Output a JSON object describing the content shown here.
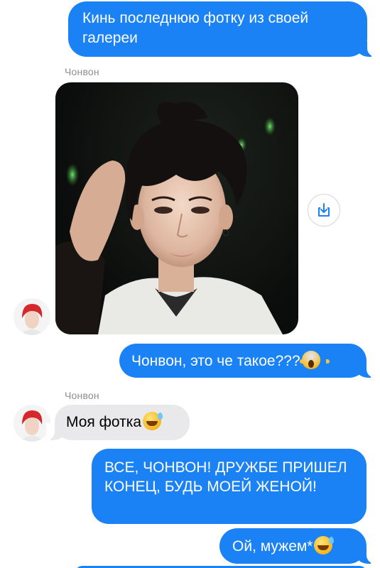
{
  "conversation": {
    "messages": [
      {
        "direction": "outgoing",
        "text": "Кинь последнюю фотку из своей галереи"
      },
      {
        "direction": "incoming",
        "sender": "Чонвон",
        "type": "image"
      },
      {
        "direction": "outgoing",
        "text": "Чонвон, это че такое???",
        "emoji": "face-screaming-in-fear"
      },
      {
        "direction": "incoming",
        "sender": "Чонвон",
        "text": "Моя фотка",
        "emoji": "grinning-face-with-sweat"
      },
      {
        "direction": "outgoing",
        "text": "ВСЕ, ЧОНВОН! ДРУЖБЕ ПРИШЕЛ КОНЕЦ, БУДЬ МОЕЙ ЖЕНОЙ!"
      },
      {
        "direction": "outgoing",
        "text": "Ой, мужем*",
        "emoji": "grinning-face-with-sweat"
      }
    ]
  },
  "colors": {
    "outgoing_bubble": "#1a82f5",
    "incoming_bubble": "#e9e9eb",
    "sender_label": "#8e8e93"
  },
  "icons": {
    "save_image": "save-to-device-icon"
  }
}
